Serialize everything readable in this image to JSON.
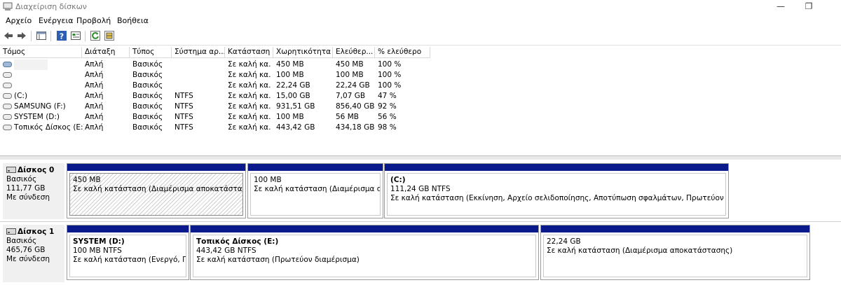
{
  "window": {
    "title": "Διαχείριση δίσκων",
    "minimize": "—",
    "restore": "❐"
  },
  "menu": [
    "Αρχείο",
    "Ενέργεια",
    "Προβολή",
    "Βοήθεια"
  ],
  "columns": [
    "Τόμος",
    "Διάταξη",
    "Τύπος",
    "Σύστημα αρ...",
    "Κατάσταση",
    "Χωρητικότητα",
    "Ελεύθερ...",
    "% ελεύθερο"
  ],
  "volumes": [
    {
      "name": "",
      "layout": "Απλή",
      "type": "Βασικός",
      "fs": "",
      "status": "Σε καλή κα...",
      "capacity": "450 MB",
      "free": "450 MB",
      "pct": "100 %"
    },
    {
      "name": "",
      "layout": "Απλή",
      "type": "Βασικός",
      "fs": "",
      "status": "Σε καλή κα...",
      "capacity": "100 MB",
      "free": "100 MB",
      "pct": "100 %"
    },
    {
      "name": "",
      "layout": "Απλή",
      "type": "Βασικός",
      "fs": "",
      "status": "Σε καλή κα...",
      "capacity": "22,24 GB",
      "free": "22,24 GB",
      "pct": "100 %"
    },
    {
      "name": "(C:)",
      "layout": "Απλή",
      "type": "Βασικός",
      "fs": "NTFS",
      "status": "Σε καλή κα...",
      "capacity": "15,00 GB",
      "free": "7,07 GB",
      "pct": "47 %"
    },
    {
      "name": "SAMSUNG (F:)",
      "layout": "Απλή",
      "type": "Βασικός",
      "fs": "NTFS",
      "status": "Σε καλή κα...",
      "capacity": "931,51 GB",
      "free": "856,40 GB",
      "pct": "92 %"
    },
    {
      "name": "SYSTEM (D:)",
      "layout": "Απλή",
      "type": "Βασικός",
      "fs": "NTFS",
      "status": "Σε καλή κα...",
      "capacity": "100 MB",
      "free": "56 MB",
      "pct": "56 %"
    },
    {
      "name": "Τοπικός Δίσκος (E:)",
      "layout": "Απλή",
      "type": "Βασικός",
      "fs": "NTFS",
      "status": "Σε καλή κα...",
      "capacity": "443,42 GB",
      "free": "434,18 GB",
      "pct": "98 %"
    }
  ],
  "disks": [
    {
      "name": "Δίσκος 0",
      "type": "Βασικός",
      "size": "111,77 GB",
      "state": "Με σύνδεση",
      "partitions": [
        {
          "title": "",
          "size": "450 MB",
          "status": "Σε καλή κατάσταση (Διαμέρισμα αποκατάστασης)"
        },
        {
          "title": "",
          "size": "100 MB",
          "status": "Σε καλή κατάσταση (Διαμέρισμα συστήματος EFI)"
        },
        {
          "title": "(C:)",
          "size": "111,24 GB NTFS",
          "status": "Σε καλή κατάσταση (Εκκίνηση, Αρχείο σελιδοποίησης, Αποτύπωση σφαλμάτων, Πρωτεύον διαμέρισμα)"
        }
      ]
    },
    {
      "name": "Δίσκος 1",
      "type": "Βασικός",
      "size": "465,76 GB",
      "state": "Με σύνδεση",
      "partitions": [
        {
          "title": "SYSTEM  (D:)",
          "size": "100 MB NTFS",
          "status": "Σε καλή κατάσταση (Ενεργό, Πρωτεύον διαμέρισμα)"
        },
        {
          "title": "Τοπικός Δίσκος  (E:)",
          "size": "443,42 GB NTFS",
          "status": "Σε καλή κατάσταση (Πρωτεύον διαμέρισμα)"
        },
        {
          "title": "",
          "size": "22,24 GB",
          "status": "Σε καλή κατάσταση (Διαμέρισμα αποκατάστασης)"
        }
      ]
    }
  ],
  "colors": {
    "partition_bar": "#0b1a8a",
    "selected_hatch": "#cfcfcf"
  }
}
